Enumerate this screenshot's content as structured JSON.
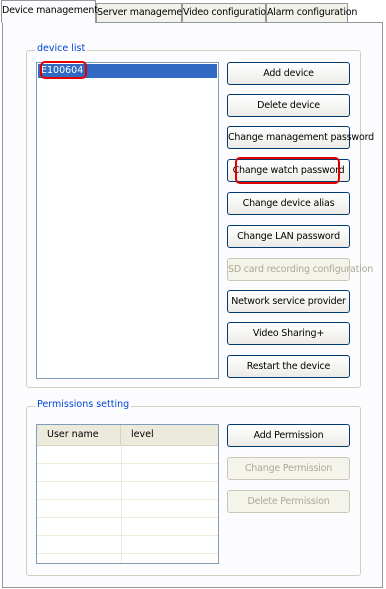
{
  "tabs": [
    {
      "label": "Device management",
      "active": true
    },
    {
      "label": "Server management",
      "active": false
    },
    {
      "label": "Video configuration",
      "active": false
    },
    {
      "label": "Alarm configuration",
      "active": false
    }
  ],
  "device_list": {
    "legend": "device list",
    "items": [
      "E100604"
    ],
    "selected": "E100604"
  },
  "device_buttons": [
    {
      "label": "Add device",
      "enabled": true
    },
    {
      "label": "Delete device",
      "enabled": true
    },
    {
      "label": "Change management password",
      "enabled": true
    },
    {
      "label": "Change watch password",
      "enabled": true
    },
    {
      "label": "Change device alias",
      "enabled": true
    },
    {
      "label": "Change LAN password",
      "enabled": true
    },
    {
      "label": "SD card recording configuration",
      "enabled": false
    },
    {
      "label": "Network service provider",
      "enabled": true
    },
    {
      "label": "Video Sharing+",
      "enabled": true
    },
    {
      "label": "Restart the device",
      "enabled": true
    }
  ],
  "permissions": {
    "legend": "Permissions setting",
    "columns": [
      "User name",
      "level"
    ],
    "rows": [],
    "buttons": [
      {
        "label": "Add Permission",
        "enabled": true
      },
      {
        "label": "Change Permission",
        "enabled": false
      },
      {
        "label": "Delete Permission",
        "enabled": false
      }
    ]
  },
  "colors": {
    "highlight": "#e00000",
    "selection": "#316ac5",
    "legend_text": "#0046d5"
  }
}
